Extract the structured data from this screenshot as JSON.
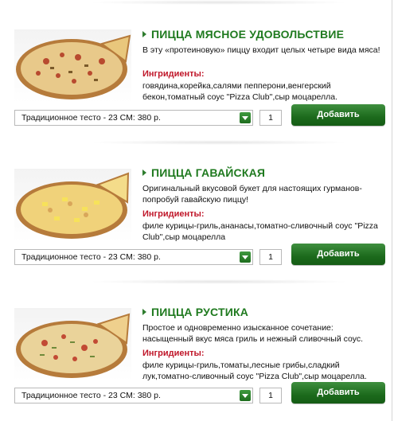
{
  "colors": {
    "title_green": "#1f7a1f",
    "ingredients_red": "#c0172a",
    "button_green": "#1c6a1c"
  },
  "products": [
    {
      "title": "ПИЦЦА МЯСНОЕ УДОВОЛЬСТВИЕ",
      "description": "В эту «протеиновую» пиццу входит целых четыре вида мяса!",
      "ingredients_label": "Ингридиенты:",
      "ingredients": "говядина,корейка,салями пепперони,венгерский бекон,томатный соус \"Pizza Club\",сыр моцарелла.",
      "option_selected": "Традиционное тесто - 23 СМ: 380 р.",
      "quantity": "1",
      "add_label": "Добавить"
    },
    {
      "title": "ПИЦЦА ГАВАЙСКАЯ",
      "description": "Оригинальный вкусовой букет для настоящих гурманов-попробуй гавайскую пиццу!",
      "ingredients_label": "Ингридиенты:",
      "ingredients": "филе курицы-гриль,ананасы,томатно-сливочный соус \"Pizza Club\",сыр моцарелла",
      "option_selected": "Традиционное тесто - 23 СМ: 380 р.",
      "quantity": "1",
      "add_label": "Добавить"
    },
    {
      "title": "ПИЦЦА РУСТИКА",
      "description": "Простое и одновременно изысканное сочетание: насыщенный вкус мяса гриль и нежный сливочный соус.",
      "ingredients_label": "Ингридиенты:",
      "ingredients": "филе курицы-гриль,томаты,лесные грибы,сладкий лук,томатно-сливочный соус \"Pizza Club\",сыр моцарелла.",
      "option_selected": "Традиционное тесто - 23 СМ: 380 р.",
      "quantity": "1",
      "add_label": "Добавить"
    }
  ]
}
